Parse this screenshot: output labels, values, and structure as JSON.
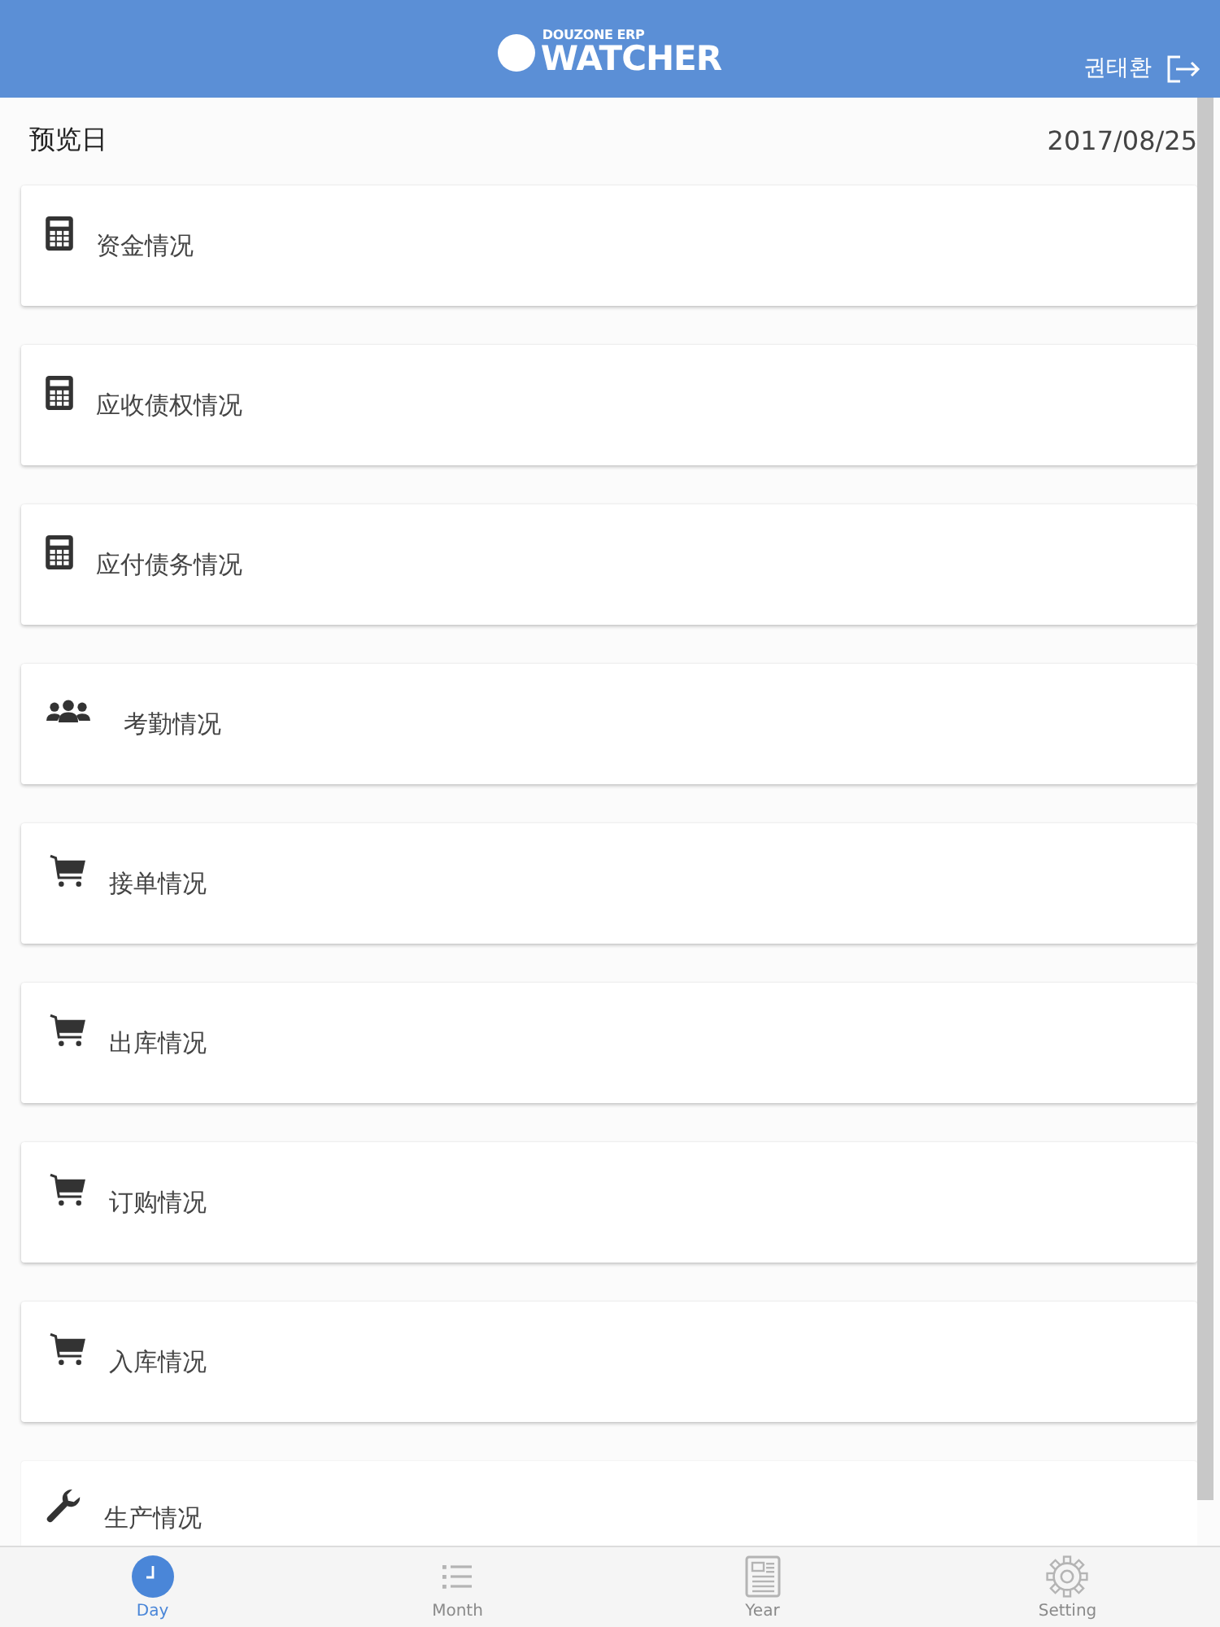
{
  "header": {
    "logo": {
      "subtitle": "DOUZONE ERP",
      "title": "WATCHER"
    },
    "user": "권태환"
  },
  "subheader": {
    "label": "预览日",
    "date": "2017/08/25"
  },
  "cards": [
    {
      "kind": "calculator",
      "label": "资金情况"
    },
    {
      "kind": "calculator",
      "label": "应收债权情况"
    },
    {
      "kind": "calculator",
      "label": "应付债务情况"
    },
    {
      "kind": "people",
      "label": "考勤情况"
    },
    {
      "kind": "cart",
      "label": "接单情况"
    },
    {
      "kind": "cart",
      "label": "出库情况"
    },
    {
      "kind": "cart",
      "label": "订购情况"
    },
    {
      "kind": "cart",
      "label": "入库情况"
    },
    {
      "kind": "wrench",
      "label": "生产情况"
    }
  ],
  "tabs": [
    {
      "kind": "clock",
      "label": "Day",
      "selected": true
    },
    {
      "kind": "list",
      "label": "Month",
      "selected": false
    },
    {
      "kind": "document",
      "label": "Year",
      "selected": false
    },
    {
      "kind": "gear",
      "label": "Setting",
      "selected": false
    }
  ]
}
